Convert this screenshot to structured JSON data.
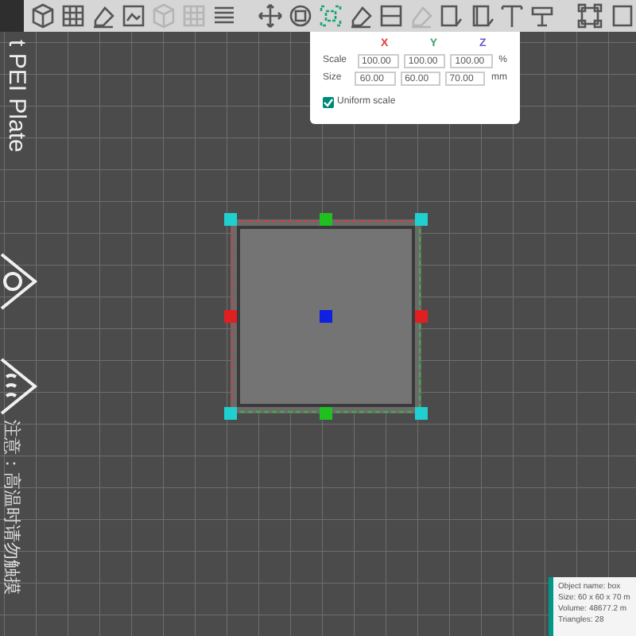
{
  "toolbar": {
    "groups": [
      [
        {
          "kind": "cube",
          "selected": false,
          "disabled": false
        },
        {
          "kind": "grid",
          "selected": false,
          "disabled": false
        },
        {
          "kind": "eraser",
          "selected": false,
          "disabled": false
        },
        {
          "kind": "image",
          "selected": false,
          "disabled": false
        },
        {
          "kind": "cube",
          "selected": false,
          "disabled": true
        },
        {
          "kind": "grid",
          "selected": false,
          "disabled": true
        },
        {
          "kind": "layers",
          "selected": false,
          "disabled": false
        }
      ],
      [
        {
          "kind": "move",
          "selected": false,
          "disabled": false
        },
        {
          "kind": "rotate",
          "selected": false,
          "disabled": false
        },
        {
          "kind": "scale",
          "selected": true,
          "disabled": false
        },
        {
          "kind": "eraser",
          "selected": false,
          "disabled": false
        },
        {
          "kind": "cut",
          "selected": false,
          "disabled": false
        },
        {
          "kind": "eraser",
          "selected": false,
          "disabled": true
        },
        {
          "kind": "support",
          "selected": false,
          "disabled": false
        },
        {
          "kind": "seam",
          "selected": false,
          "disabled": false
        },
        {
          "kind": "text",
          "selected": false,
          "disabled": false
        },
        {
          "kind": "measure",
          "selected": false,
          "disabled": false
        }
      ],
      [
        {
          "kind": "frame",
          "selected": false,
          "disabled": false
        },
        {
          "kind": "edge",
          "selected": false,
          "disabled": false
        }
      ]
    ]
  },
  "bed_labels": [
    {
      "text": "t PEI Plate"
    },
    {
      "text": "注意：高温时请勿触摸"
    }
  ],
  "scale_panel": {
    "axes": [
      {
        "label": "X",
        "color": "#e04040"
      },
      {
        "label": "Y",
        "color": "#40a070"
      },
      {
        "label": "Z",
        "color": "#6a5acd"
      }
    ],
    "rows": [
      {
        "label": "Scale",
        "values": [
          "100.00",
          "100.00",
          "100.00"
        ],
        "unit": "%"
      },
      {
        "label": "Size",
        "values": [
          "60.00",
          "60.00",
          "70.00"
        ],
        "unit": "mm"
      }
    ],
    "uniform_scale": {
      "label": "Uniform scale",
      "checked": true
    }
  },
  "object_info": {
    "lines": [
      "Object name: box",
      "Size: 60 x 60 x 70 m",
      "Volume: 48677.2 m",
      "Triangles: 28"
    ]
  }
}
